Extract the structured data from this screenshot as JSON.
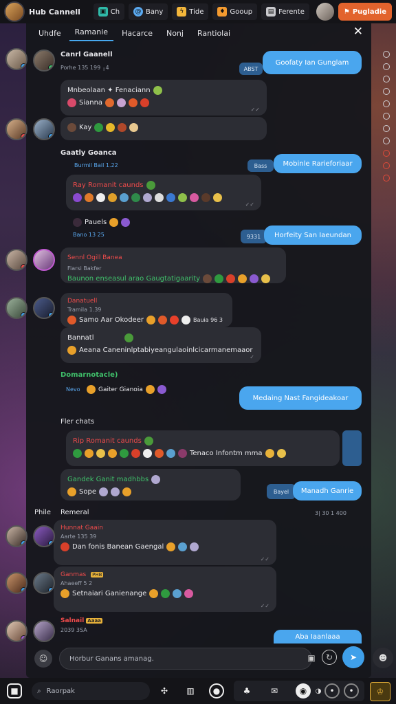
{
  "topbar": {
    "title": "Hub Cannell",
    "tabs": [
      {
        "label": "Ch",
        "icon": "chat-icon",
        "color": "#2fb9a8"
      },
      {
        "label": "Bany",
        "icon": "at-icon",
        "color": "#5aa9f0"
      },
      {
        "label": "Tide",
        "icon": "bolt-icon",
        "color": "#f3b63b"
      },
      {
        "label": "Gooup",
        "icon": "group-icon",
        "color": "#f39a2f"
      },
      {
        "label": "Ferente",
        "icon": "file-icon",
        "color": "#c8c8cc"
      }
    ],
    "cta_label": "Pugladie"
  },
  "panel": {
    "tabs": [
      "Uhdfe",
      "Ramanie",
      "Hacarce",
      "Nonj",
      "Rantiolai"
    ],
    "active_tab": 1
  },
  "messages": [
    {
      "name": "Canrl Gaanell",
      "sub": "Porhe 135 199 ╷4",
      "me": "Goofaty Ian Gunglam",
      "me_time": "ABST"
    },
    {
      "line1": "Mnbeolaan ✦ Fenaciann",
      "line2": "Sianna"
    },
    {
      "line1": "Kay"
    },
    {
      "name": "Gaatly Goanca",
      "sub": "Burmil Bail 1.22",
      "me": "Mobinle Rarieforiaar",
      "me_time": "Bass"
    },
    {
      "line1": "Ray Romanit caunds",
      "reply_name": "Pauels",
      "reply_sub": "Bano 13 25",
      "me": "Horfeity San Iaeundan",
      "me_time": "9331"
    },
    {
      "name": "Sennl Ogill Banea",
      "sub": "Fiarsi Bakfer",
      "line": "Baunon enseasul arao Gaugtatigaarity"
    },
    {
      "name": "Danatuell",
      "sub": "Tramila 1.39",
      "line": "Samo Aar Okodeer",
      "sub2": "Bauia 96 3"
    },
    {
      "name": "Bannatl",
      "line": "Aeana Caneninlptabiyeangulaoinlcicarmanemaaor"
    },
    {
      "name": "Domarnotacle)",
      "sub": "Nevo",
      "line": "Gaiter Gianoia",
      "me": "Medaing Nast Fangideakoar",
      "me_time": ""
    },
    {
      "section": "Fler chats"
    },
    {
      "line1": "Rip Romanit caunds",
      "line2": "Tenaco Infontm mma"
    },
    {
      "line1": "Gandek Ganit madhbbs",
      "line2": "Sope",
      "me": "Manadh Ganrie",
      "me_time": "Bayel"
    },
    {
      "section": "Phile",
      "right": "Remeral",
      "time": "3| 30 1 400"
    },
    {
      "name": "Hunnat Gaain",
      "sub": "Aarte 135 39",
      "line": "Dan fonis Banean Gaengal"
    },
    {
      "name": "Ganmas",
      "tag": "PHB",
      "sub": "Ahaeeff 5 2",
      "line": "Setnaiari Ganienange"
    },
    {
      "name": "Salnail",
      "tag": "Aaaa",
      "sub": "2039 3SA",
      "me": "Aba Iaanlaaa"
    }
  ],
  "composer": {
    "placeholder": "Horbur Ganans amanag."
  },
  "bottombar": {
    "search_label": "Raorpak"
  }
}
